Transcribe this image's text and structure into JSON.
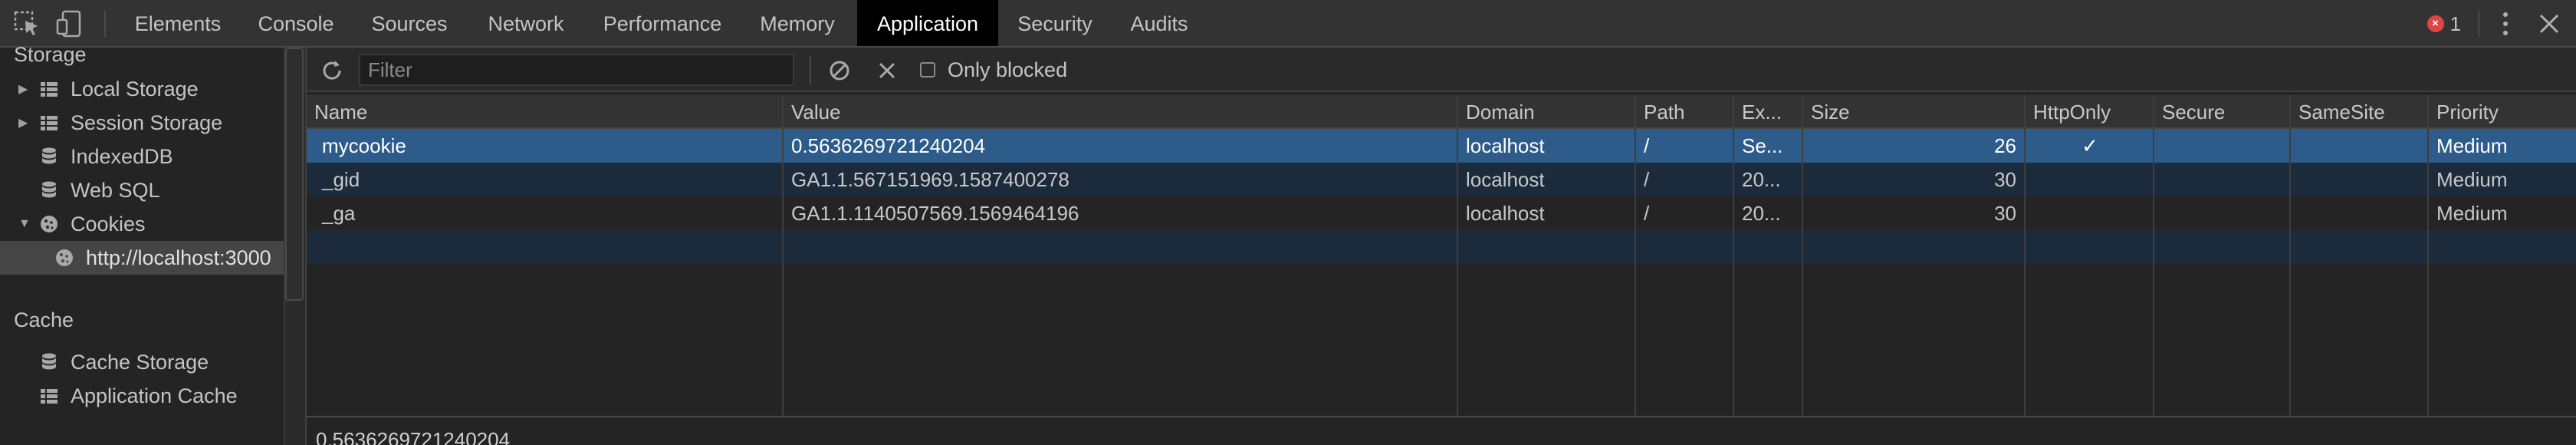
{
  "tabs": [
    {
      "label": "Elements"
    },
    {
      "label": "Console"
    },
    {
      "label": "Sources"
    },
    {
      "label": "Network"
    },
    {
      "label": "Performance"
    },
    {
      "label": "Memory"
    },
    {
      "label": "Application",
      "active": true
    },
    {
      "label": "Security"
    },
    {
      "label": "Audits"
    }
  ],
  "error_count": "1",
  "sidebar": {
    "storage_heading": "Storage",
    "items": [
      {
        "label": "Local Storage",
        "icon": "grid-icon",
        "expandable": true
      },
      {
        "label": "Session Storage",
        "icon": "grid-icon",
        "expandable": true
      },
      {
        "label": "IndexedDB",
        "icon": "database-icon"
      },
      {
        "label": "Web SQL",
        "icon": "database-icon"
      },
      {
        "label": "Cookies",
        "icon": "cookie-icon",
        "expanded": true
      },
      {
        "label": "http://localhost:3000",
        "icon": "cookie-icon",
        "selected": true
      }
    ],
    "cache_heading": "Cache",
    "cache_items": [
      {
        "label": "Cache Storage",
        "icon": "database-icon"
      },
      {
        "label": "Application Cache",
        "icon": "grid-icon"
      }
    ]
  },
  "toolbar": {
    "filter_placeholder": "Filter",
    "only_blocked_label": "Only blocked"
  },
  "table": {
    "columns": [
      "Name",
      "Value",
      "Domain",
      "Path",
      "Ex...",
      "Size",
      "HttpOnly",
      "Secure",
      "SameSite",
      "Priority"
    ],
    "rows": [
      {
        "name": "mycookie",
        "value": "0.5636269721240204",
        "domain": "localhost",
        "path": "/",
        "expires": "Se...",
        "size": "26",
        "httponly": "✓",
        "secure": "",
        "samesite": "",
        "priority": "Medium"
      },
      {
        "name": "_gid",
        "value": "GA1.1.567151969.1587400278",
        "domain": "localhost",
        "path": "/",
        "expires": "20...",
        "size": "30",
        "httponly": "",
        "secure": "",
        "samesite": "",
        "priority": "Medium"
      },
      {
        "name": "_ga",
        "value": "GA1.1.1140507569.1569464196",
        "domain": "localhost",
        "path": "/",
        "expires": "20...",
        "size": "30",
        "httponly": "",
        "secure": "",
        "samesite": "",
        "priority": "Medium"
      }
    ]
  },
  "selected_value": "0.5636269721240204",
  "colors": {
    "selected_row": "#2d5c8a",
    "alt_row": "#1c2b3c",
    "error": "#e04545"
  }
}
